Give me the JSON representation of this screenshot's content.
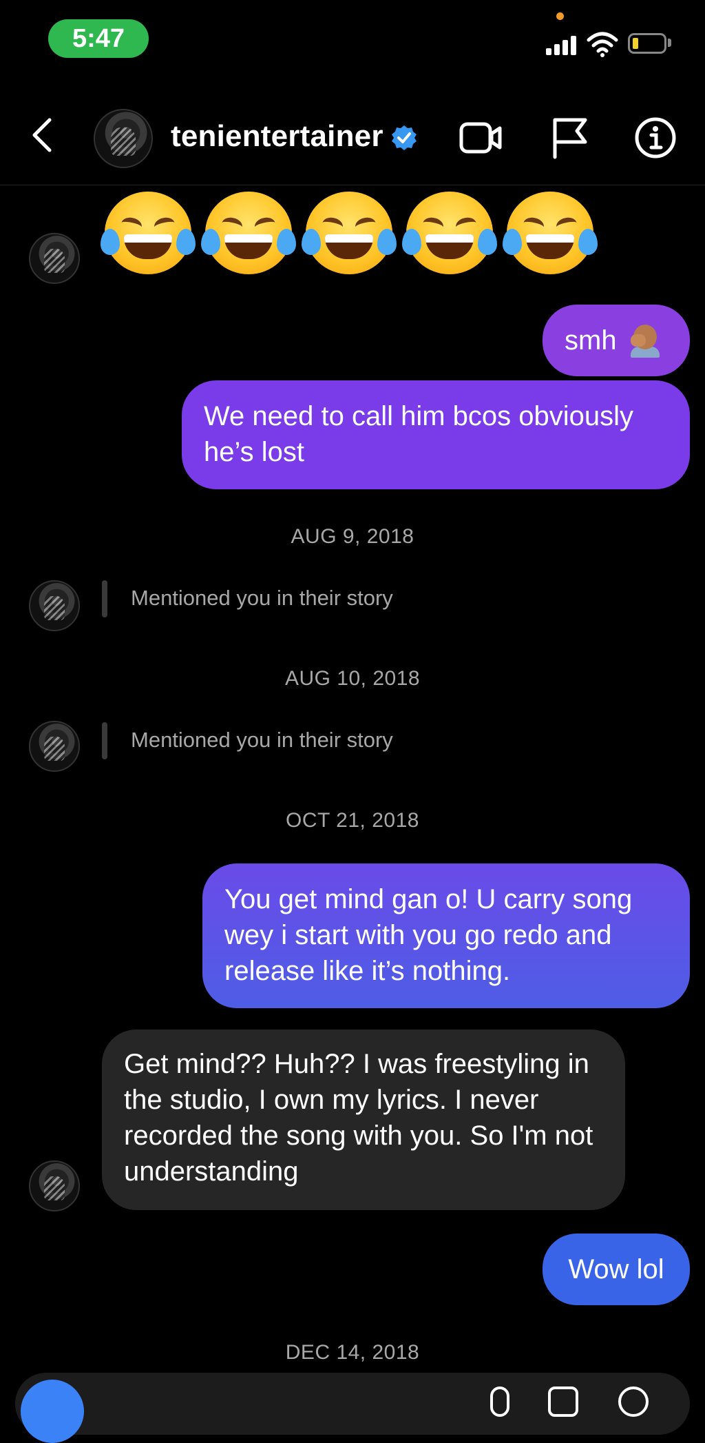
{
  "status_bar": {
    "time": "5:47",
    "time_pill_color": "#2fb84f"
  },
  "header": {
    "username": "tenientertainer",
    "verified": true,
    "icons": [
      "back-icon",
      "video-call-icon",
      "flag-icon",
      "info-icon"
    ]
  },
  "messages": {
    "emoji_reaction": "😂😂😂😂😂",
    "smh": "smh",
    "lost": "We need to call him bcos obviously he’s lost",
    "date_1": "AUG 9, 2018",
    "mention_1": "Mentioned you in their story",
    "date_2": "AUG 10, 2018",
    "mention_2": "Mentioned you in their story",
    "date_3": "OCT 21, 2018",
    "mind": "You get mind gan o! U carry song wey i start with you go redo and release like it’s nothing.",
    "freestyle": "Get mind?? Huh?? I was freestyling in the studio, I own my lyrics. I never recorded the song with you. So I'm not understanding",
    "wow": "Wow lol",
    "date_4": "DEC 14, 2018"
  },
  "colors": {
    "outgoing_purple": "#8a3fe0",
    "outgoing_gradient_start": "#6a4be8",
    "outgoing_blue": "#3a64e8",
    "incoming": "#262626",
    "background": "#000000"
  }
}
